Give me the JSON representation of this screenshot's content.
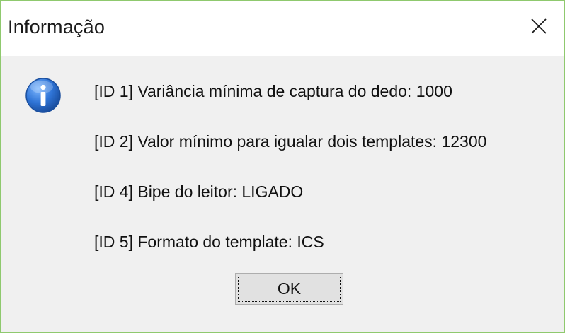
{
  "window": {
    "title": "Informação",
    "close_icon": "close-icon"
  },
  "dialog": {
    "icon": "info-icon",
    "messages": [
      "[ID 1] Variância mínima de captura do dedo: 1000",
      "[ID 2] Valor mínimo para igualar dois templates: 12300",
      "[ID 4] Bipe do leitor: LIGADO",
      "[ID 5] Formato do template: ICS"
    ],
    "ok_label": "OK"
  },
  "colors": {
    "window_border": "#8fc96e",
    "titlebar_bg": "#ffffff",
    "body_bg": "#f0f0f0",
    "button_bg": "#e1e1e1",
    "info_icon_blue": "#1f5fbf"
  }
}
